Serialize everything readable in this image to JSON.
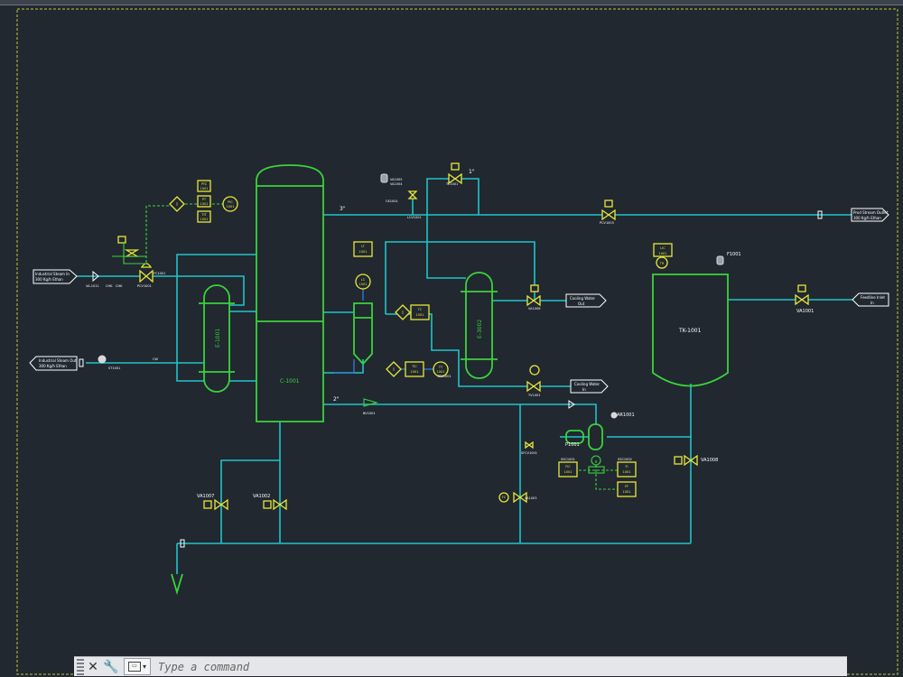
{
  "colors": {
    "background": "#212830",
    "process_line": "#21c4c9",
    "equipment": "#3cd23c",
    "instrument": "#e8e83a",
    "label": "#ffffff",
    "frame": "#c8c832"
  },
  "streams": {
    "industrial_steam_in": [
      "Industrial Steam In",
      "300 Kg/h Ethan"
    ],
    "industrial_steam_out": [
      "Industrial Steam Out",
      "300 Kg/h Ethan"
    ],
    "cooling_water_out": [
      "Cooling Water",
      "Out"
    ],
    "cooling_water_in": [
      "Cooling Water",
      "In"
    ],
    "product_out": [
      "Prod Stream Outlet",
      "300 Kg/h Ethan"
    ],
    "feed_in": [
      "Feedline Inlet",
      "In"
    ]
  },
  "equipment": {
    "column": "C-1001",
    "reboiler": "E-1001",
    "condenser": "E-3002",
    "tank": "TK-1001"
  },
  "labels": {
    "pipe_3in": "3\"",
    "pipe_2in": "2\"",
    "pipe_1in": "1\"",
    "f1001": "F1001",
    "va1007": "VA1007",
    "va1002": "VA1002",
    "va1001": "VA1001",
    "va1008": "VA1008",
    "p1001": "P1001",
    "ar1001": "AR1001",
    "fc1001": "FC1001",
    "va1011": "VA-1011",
    "chk1": "CHK",
    "chk2": "CHK",
    "pcv1001": "PCV1001",
    "cw": "CW",
    "st1001": "ST1001",
    "bv1001": "BV1001",
    "va1005": "VA1005",
    "va1004": "VA1004",
    "tc1001": "TC1001",
    "ck1001": "CK1001",
    "lcv1001": "LCV1001",
    "pcv1003": "PCV1003",
    "va1006": "VA1006",
    "tv1001": "TV1001",
    "tcv1001": "TCV1001",
    "va1003": "VA1003",
    "ssc1001": "SSC1001",
    "ssc1002": "SSC1002",
    "sfcv1001": "SFCV1001"
  },
  "instruments": {
    "ptc": [
      "PTC",
      "1001"
    ],
    "pt": [
      "PT",
      "1001"
    ],
    "tit": [
      "TIT",
      "1001"
    ],
    "lt": [
      "LT",
      "1001"
    ],
    "tc1": [
      "TC",
      "1001"
    ],
    "tic": [
      "TIC",
      "1001"
    ],
    "tt": [
      "TT",
      "1001"
    ],
    "lc": [
      "LC",
      "1001"
    ],
    "tic2": [
      "TIC",
      "1001"
    ],
    "tr": [
      "TR",
      "1001"
    ],
    "pic": [
      "PIC",
      "1001"
    ],
    "lic": [
      "LIC",
      "1001"
    ],
    "fic": [
      "FIC",
      "1001"
    ],
    "fi": [
      "FI",
      "1001"
    ],
    "fc": [
      "FC",
      "1001"
    ],
    "fi2": [
      "FI",
      "1001"
    ],
    "ff": [
      "FF",
      "1001"
    ],
    "diamond_i": "I"
  },
  "command_line": {
    "placeholder": "Type a command"
  }
}
